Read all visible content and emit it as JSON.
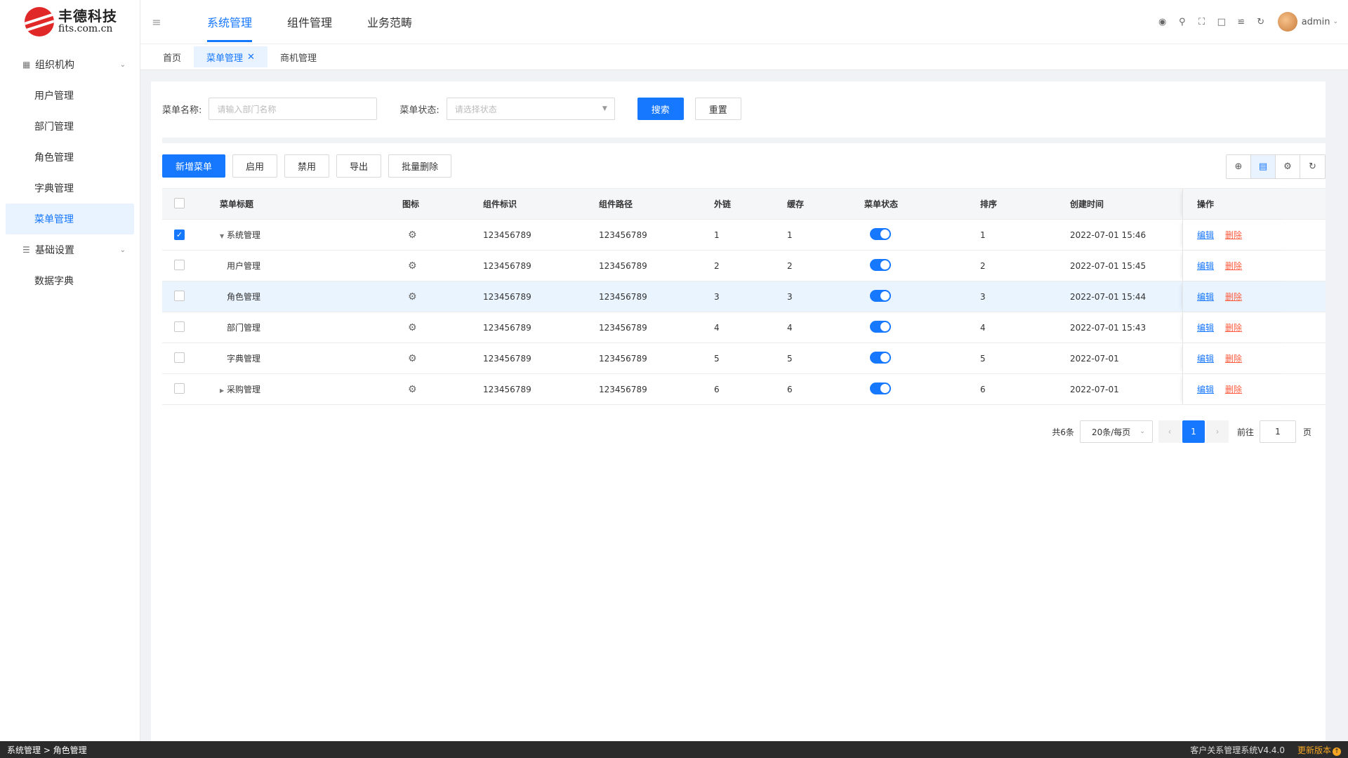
{
  "brand": {
    "name": "丰德科技",
    "domain": "fits.com.cn"
  },
  "sidebar": {
    "groups": [
      {
        "label": "组织机构",
        "icon": "org-icon"
      },
      {
        "label": "基础设置",
        "icon": "settings-sliders-icon"
      }
    ],
    "items": [
      {
        "label": "用户管理"
      },
      {
        "label": "部门管理"
      },
      {
        "label": "角色管理"
      },
      {
        "label": "字典管理"
      },
      {
        "label": "菜单管理",
        "active": true
      },
      {
        "label": "数据字典"
      }
    ]
  },
  "topnav": [
    {
      "label": "系统管理",
      "active": true
    },
    {
      "label": "组件管理"
    },
    {
      "label": "业务范畴"
    }
  ],
  "user": {
    "name": "admin"
  },
  "tabs": [
    {
      "label": "首页"
    },
    {
      "label": "菜单管理",
      "active": true
    },
    {
      "label": "商机管理"
    }
  ],
  "search": {
    "name_label": "菜单名称:",
    "name_placeholder": "请输入部门名称",
    "status_label": "菜单状态:",
    "status_placeholder": "请选择状态",
    "search_button": "搜索",
    "reset_button": "重置"
  },
  "toolbar": {
    "add": "新增菜单",
    "enable": "启用",
    "disable": "禁用",
    "export": "导出",
    "batch_delete": "批量删除"
  },
  "table": {
    "headers": {
      "title": "菜单标题",
      "icon": "图标",
      "component": "组件标识",
      "path": "组件路径",
      "external": "外链",
      "cache": "缓存",
      "status": "菜单状态",
      "sort": "排序",
      "created": "创建时间",
      "ops": "操作"
    },
    "edit_label": "编辑",
    "delete_label": "删除",
    "rows": [
      {
        "title": "系统管理",
        "component": "123456789",
        "path": "123456789",
        "external": "1",
        "cache": "1",
        "sort": "1",
        "created": "2022-07-01 15:46"
      },
      {
        "title": "用户管理",
        "component": "123456789",
        "path": "123456789",
        "external": "2",
        "cache": "2",
        "sort": "2",
        "created": "2022-07-01 15:45"
      },
      {
        "title": "角色管理",
        "component": "123456789",
        "path": "123456789",
        "external": "3",
        "cache": "3",
        "sort": "3",
        "created": "2022-07-01 15:44"
      },
      {
        "title": "部门管理",
        "component": "123456789",
        "path": "123456789",
        "external": "4",
        "cache": "4",
        "sort": "4",
        "created": "2022-07-01 15:43"
      },
      {
        "title": "字典管理",
        "component": "123456789",
        "path": "123456789",
        "external": "5",
        "cache": "5",
        "sort": "5",
        "created": "2022-07-01"
      },
      {
        "title": "采购管理",
        "component": "123456789",
        "path": "123456789",
        "external": "6",
        "cache": "6",
        "sort": "6",
        "created": "2022-07-01"
      }
    ]
  },
  "pagination": {
    "total": "共6条",
    "page_size": "20条/每页",
    "current": "1",
    "goto_label": "前往",
    "goto_value": "1",
    "unit": "页"
  },
  "statusbar": {
    "breadcrumb": "系统管理 > 角色管理",
    "version": "客户关系管理系统V4.4.0",
    "update": "更新版本"
  },
  "colors": {
    "primary": "#1677ff",
    "danger": "#ff5a3c",
    "statusbar": "#2b2b2b"
  }
}
